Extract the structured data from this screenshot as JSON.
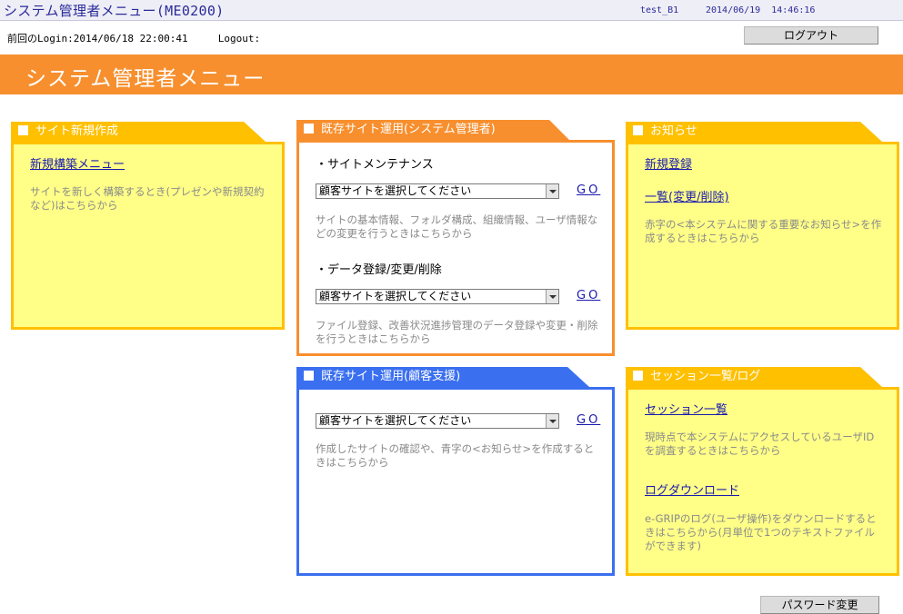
{
  "window": {
    "title": "システム管理者メニュー(ME0200)",
    "user": "test_B1",
    "datetime": "2014/06/19  14:46:16"
  },
  "session": {
    "last_login": "前回のLogin:2014/06/18 22:00:41",
    "logout_label": "Logout:",
    "logout_button": "ログアウト"
  },
  "banner": {
    "title": "システム管理者メニュー"
  },
  "panels": {
    "new_site": {
      "title": "サイト新規作成",
      "link": "新規構築メニュー",
      "desc": "サイトを新しく構築するとき(プレゼンや新規契約など)はこちらから"
    },
    "existing_admin": {
      "title": "既存サイト運用(システム管理者)",
      "section1_title": "・サイトメンテナンス",
      "section1_select": "顧客サイトを選択してください",
      "section1_go": "GO",
      "section1_desc": "サイトの基本情報、フォルダ構成、組織情報、ユーザ情報などの変更を行うときはこちらから",
      "section2_title": "・データ登録/変更/削除",
      "section2_select": "顧客サイトを選択してください",
      "section2_go": "GO",
      "section2_desc": "ファイル登録、改善状況進捗管理のデータ登録や変更・削除を行うときはこちらから"
    },
    "existing_support": {
      "title": "既存サイト運用(顧客支援)",
      "select": "顧客サイトを選択してください",
      "go": "GO",
      "desc": "作成したサイトの確認や、青字の<お知らせ>を作成するときはこちらから"
    },
    "news": {
      "title": "お知らせ",
      "link1": "新規登録",
      "link2": "一覧(変更/削除)",
      "desc": "赤字の<本システムに関する重要なお知らせ>を作成するときはこちらから"
    },
    "session_log": {
      "title": "セッション一覧/ログ",
      "link1": "セッション一覧",
      "desc1": "現時点で本システムにアクセスしているユーザIDを調査するときはこちらから",
      "link2": "ログダウンロード",
      "desc2": "e-GRIPのログ(ユーザ操作)をダウンロードするときはこちらから(月単位で1つのテキストファイルができます)"
    }
  },
  "footer": {
    "password_button": "パスワード変更"
  },
  "colors": {
    "orange": "#f78f2e",
    "yellow_tab": "#ffc000",
    "yellow_bg": "#ffff88",
    "blue": "#3a6ff0"
  }
}
